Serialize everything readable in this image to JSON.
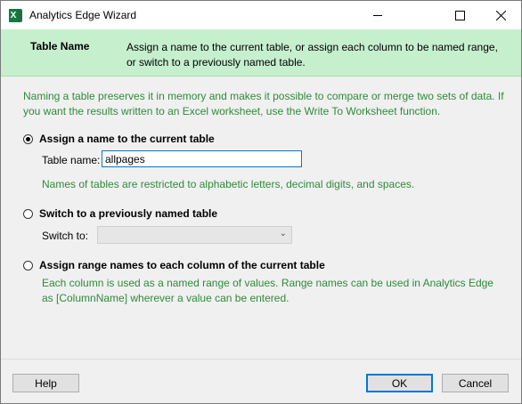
{
  "window": {
    "title": "Analytics Edge Wizard",
    "app_icon_letter": "X"
  },
  "header": {
    "title": "Table Name",
    "description": "Assign a name to the current table, or assign each column to be named range, or switch to a previously named table."
  },
  "intro_text": "Naming a table preserves it in memory and makes it possible to compare or merge two sets of data. If you want the results written to an Excel worksheet, use the Write To Worksheet function.",
  "options": {
    "assign": {
      "label": "Assign a name to the current table",
      "selected": true,
      "field_label": "Table name:",
      "field_value": "allpages",
      "hint": "Names of tables are restricted to alphabetic letters, decimal digits, and spaces."
    },
    "switch": {
      "label": "Switch to a previously named table",
      "selected": false,
      "field_label": "Switch to:",
      "field_value": ""
    },
    "range": {
      "label": "Assign range names to each column of the current table",
      "selected": false,
      "hint": "Each column is used as a named range of values. Range names can be used in Analytics Edge as [ColumnName] wherever a value can be entered."
    }
  },
  "buttons": {
    "help": "Help",
    "ok": "OK",
    "cancel": "Cancel"
  },
  "colors": {
    "header_bg": "#c6efce",
    "hint_text": "#2e8b3a",
    "accent": "#0078d7"
  }
}
